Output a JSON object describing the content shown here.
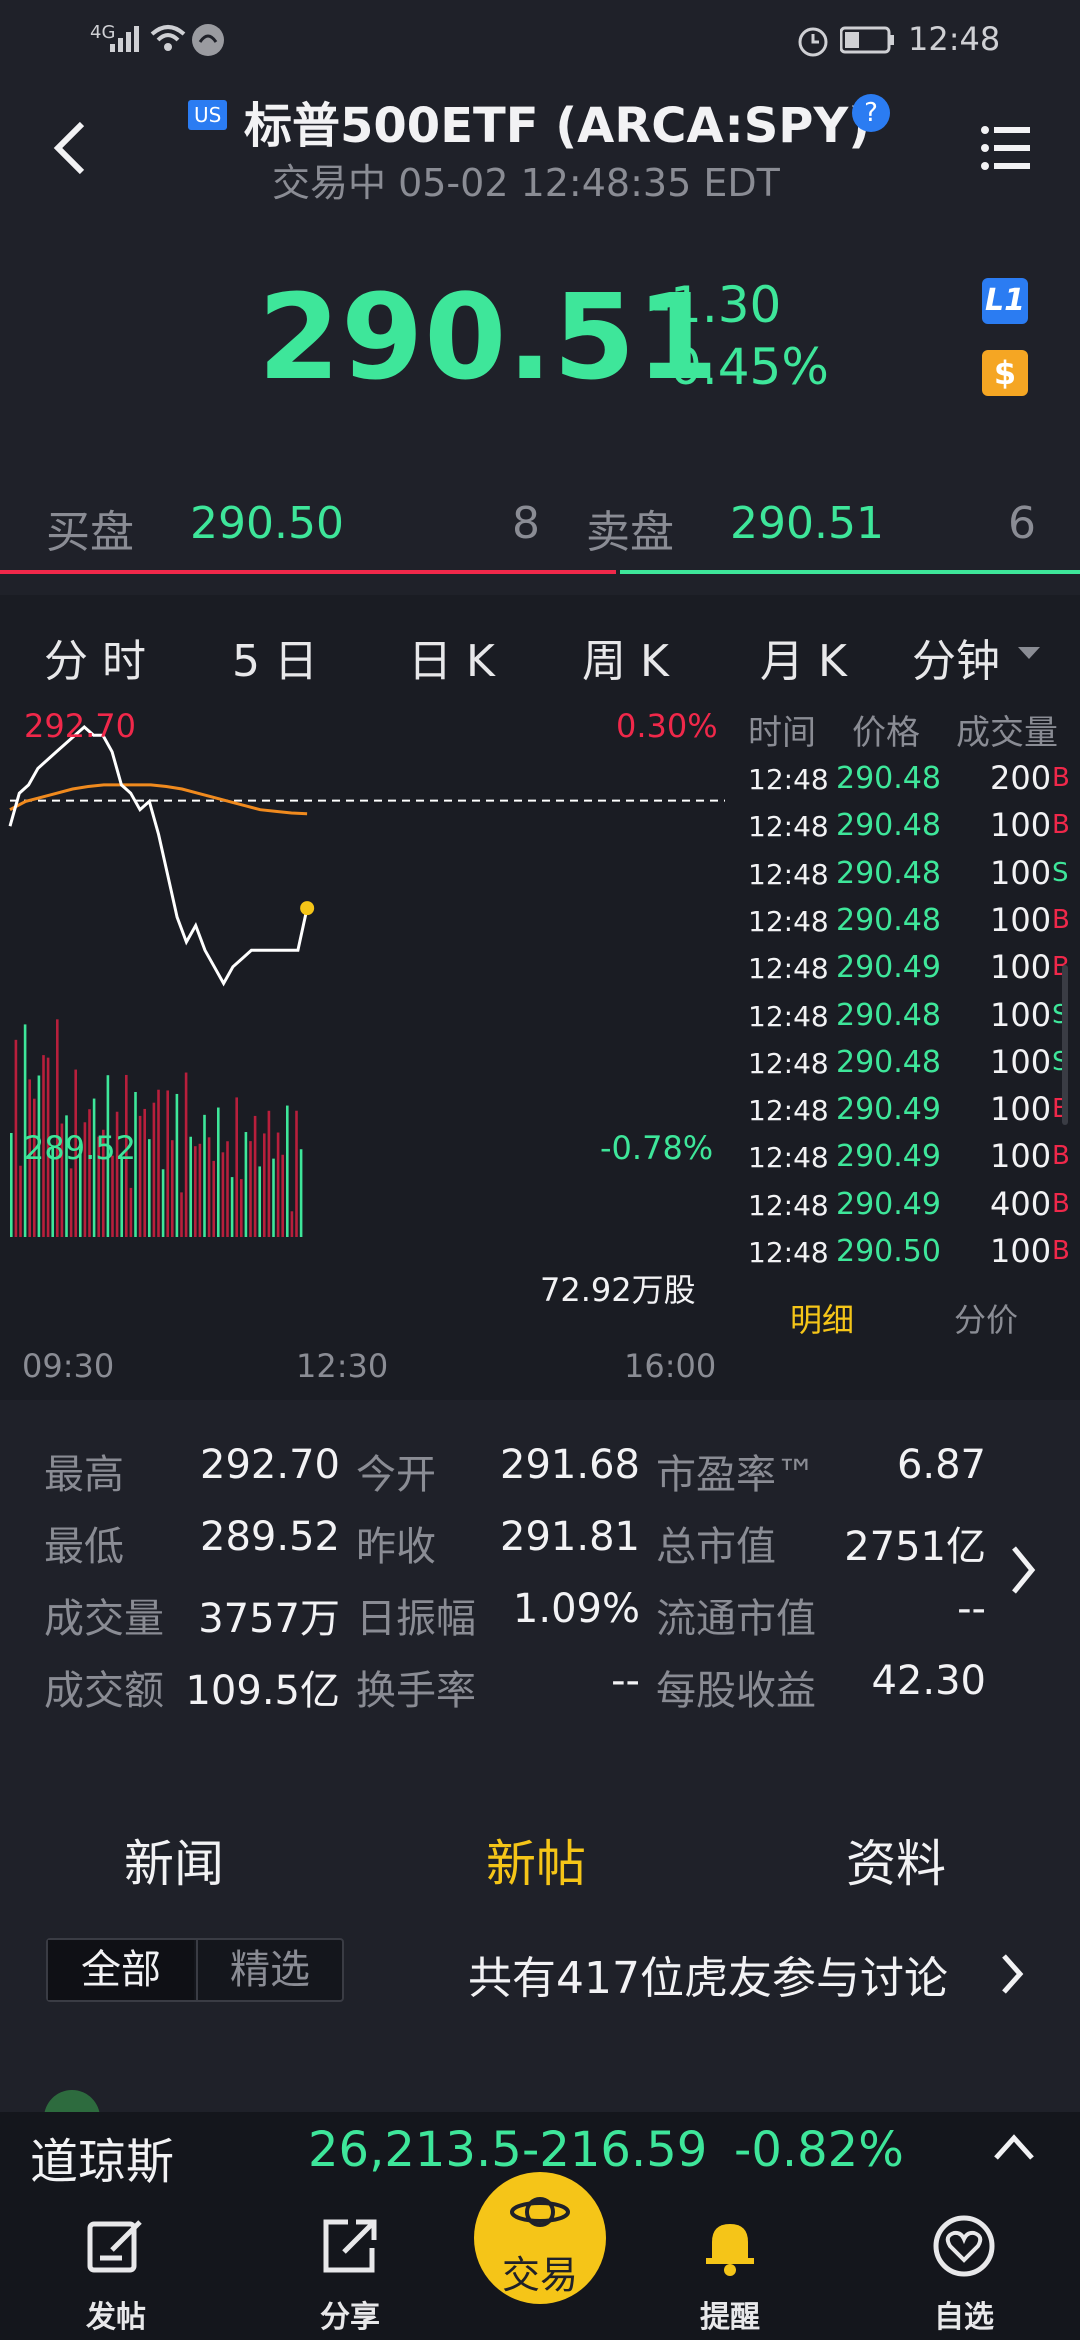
{
  "status_bar": {
    "network": "4G",
    "time": "12:48"
  },
  "header": {
    "market_badge": "US",
    "title": "标普500ETF (ARCA:SPY)",
    "help": "?",
    "subtitle": "交易中 05-02 12:48:35 EDT"
  },
  "quote": {
    "price": "290.51",
    "change": "-1.30",
    "change_pct": "-0.45%",
    "level_badge": "L1",
    "dollar_badge": "$"
  },
  "bid_ask": {
    "bid_label": "买盘",
    "bid_price": "290.50",
    "bid_size": "8",
    "ask_label": "卖盘",
    "ask_price": "290.51",
    "ask_size": "6",
    "bid_ratio": 0.57
  },
  "chart_tabs": [
    "分 时",
    "5 日",
    "日 K",
    "周 K",
    "月 K",
    "分钟"
  ],
  "chart_data": {
    "type": "line",
    "top_price": "292.70",
    "top_pct": "0.30%",
    "bottom_price": "289.52",
    "bottom_pct": "-0.78%",
    "volume_label": "72.92万股",
    "x_ticks": [
      "09:30",
      "12:30",
      "16:00"
    ],
    "ylim": [
      289.52,
      292.7
    ],
    "prev_close": 291.81,
    "series": [
      {
        "values": [
          291.5,
          291.9,
          292.0,
          292.2,
          292.3,
          292.4,
          292.5,
          292.6,
          292.7,
          292.6,
          292.6,
          292.4,
          292.0,
          291.9,
          291.7,
          291.8,
          291.4,
          290.9,
          290.4,
          290.1,
          290.3,
          290.0,
          289.8,
          289.6,
          289.8,
          289.9,
          290.0,
          290.0,
          290.0,
          290.0,
          290.0,
          290.0,
          290.51
        ]
      },
      {
        "values": [
          291.7,
          291.8,
          291.85,
          291.9,
          291.95,
          291.98,
          292.0,
          292.0,
          292.0,
          292.0,
          291.98,
          291.95,
          291.9,
          291.85,
          291.8,
          291.75,
          291.7,
          291.68,
          291.66,
          291.65
        ]
      }
    ]
  },
  "ticks_table": {
    "headers": [
      "时间",
      "价格",
      "成交量"
    ],
    "rows": [
      {
        "time": "12:48",
        "price": "290.48",
        "vol": "200",
        "side": "B"
      },
      {
        "time": "12:48",
        "price": "290.48",
        "vol": "100",
        "side": "B"
      },
      {
        "time": "12:48",
        "price": "290.48",
        "vol": "100",
        "side": "S"
      },
      {
        "time": "12:48",
        "price": "290.48",
        "vol": "100",
        "side": "B"
      },
      {
        "time": "12:48",
        "price": "290.49",
        "vol": "100",
        "side": "B"
      },
      {
        "time": "12:48",
        "price": "290.48",
        "vol": "100",
        "side": "S"
      },
      {
        "time": "12:48",
        "price": "290.48",
        "vol": "100",
        "side": "S"
      },
      {
        "time": "12:48",
        "price": "290.49",
        "vol": "100",
        "side": "B"
      },
      {
        "time": "12:48",
        "price": "290.49",
        "vol": "100",
        "side": "B"
      },
      {
        "time": "12:48",
        "price": "290.49",
        "vol": "400",
        "side": "B"
      },
      {
        "time": "12:48",
        "price": "290.50",
        "vol": "100",
        "side": "B"
      }
    ],
    "detail_tab": "明细",
    "price_tab": "分价"
  },
  "stats": [
    [
      {
        "label": "最高",
        "value": "292.70"
      },
      {
        "label": "今开",
        "value": "291.68"
      },
      {
        "label": "市盈率™",
        "value": "6.87"
      }
    ],
    [
      {
        "label": "最低",
        "value": "289.52"
      },
      {
        "label": "昨收",
        "value": "291.81"
      },
      {
        "label": "总市值",
        "value": "2751亿"
      }
    ],
    [
      {
        "label": "成交量",
        "value": "3757万"
      },
      {
        "label": "日振幅",
        "value": "1.09%"
      },
      {
        "label": "流通市值",
        "value": "--"
      }
    ],
    [
      {
        "label": "成交额",
        "value": "109.5亿"
      },
      {
        "label": "换手率",
        "value": "--"
      },
      {
        "label": "每股收益",
        "value": "42.30"
      }
    ]
  ],
  "news_tabs": {
    "news": "新闻",
    "posts": "新帖",
    "info": "资料"
  },
  "filter": {
    "all": "全部",
    "featured": "精选",
    "discussion": "共有417位虎友参与讨论"
  },
  "ticker": {
    "name": "道琼斯",
    "value": "26,213.5",
    "change": "-216.59",
    "pct": "-0.82%"
  },
  "bottom_nav": {
    "post": "发帖",
    "share": "分享",
    "trade": "交易",
    "alert": "提醒",
    "watch": "自选"
  },
  "colors": {
    "up": "#f0284a",
    "down": "#3ee69a",
    "accent": "#f5c518",
    "bg": "#1f2129"
  }
}
